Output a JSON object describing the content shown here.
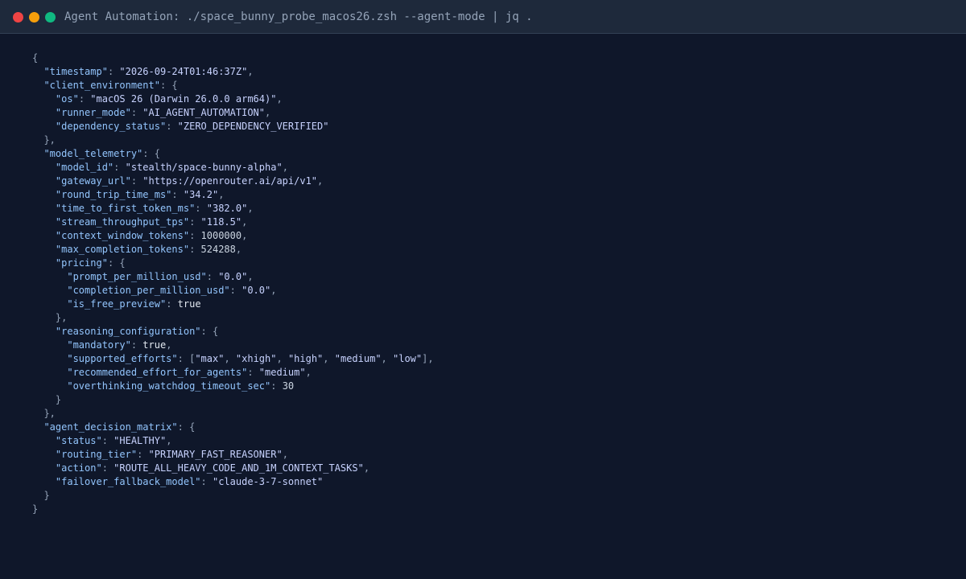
{
  "window": {
    "title": "Agent Automation: ./space_bunny_probe_macos26.zsh --agent-mode | jq .",
    "buttons": [
      "close",
      "minimize",
      "maximize"
    ]
  },
  "colors": {
    "background": "#0f172a",
    "titlebar": "#1e293b",
    "close": "#ef4444",
    "minimize": "#f59e0b",
    "maximize": "#10b981",
    "key": "#93c5fd",
    "string": "#c7d2fe",
    "punctuation": "#94a3b8"
  },
  "output": {
    "timestamp": "2026-09-24T01:46:37Z",
    "client_environment": {
      "os": "macOS 26 (Darwin 26.0.0 arm64)",
      "runner_mode": "AI_AGENT_AUTOMATION",
      "dependency_status": "ZERO_DEPENDENCY_VERIFIED"
    },
    "model_telemetry": {
      "model_id": "stealth/space-bunny-alpha",
      "gateway_url": "https://openrouter.ai/api/v1",
      "round_trip_time_ms": "34.2",
      "time_to_first_token_ms": "382.0",
      "stream_throughput_tps": "118.5",
      "context_window_tokens": 1000000,
      "max_completion_tokens": 524288,
      "pricing": {
        "prompt_per_million_usd": "0.0",
        "completion_per_million_usd": "0.0",
        "is_free_preview": true
      },
      "reasoning_configuration": {
        "mandatory": true,
        "supported_efforts": [
          "max",
          "xhigh",
          "high",
          "medium",
          "low"
        ],
        "recommended_effort_for_agents": "medium",
        "overthinking_watchdog_timeout_sec": 30
      }
    },
    "agent_decision_matrix": {
      "status": "HEALTHY",
      "routing_tier": "PRIMARY_FAST_REASONER",
      "action": "ROUTE_ALL_HEAVY_CODE_AND_1M_CONTEXT_TASKS",
      "failover_fallback_model": "claude-3-7-sonnet"
    }
  }
}
